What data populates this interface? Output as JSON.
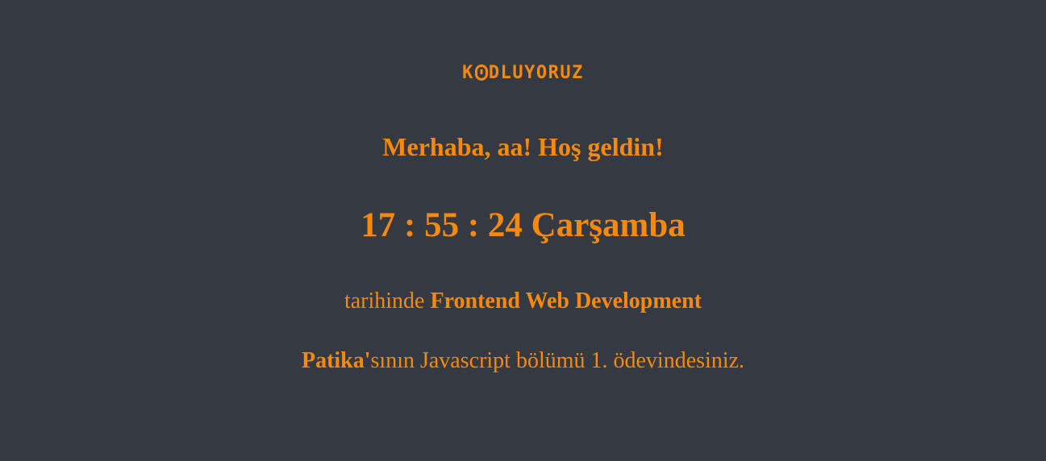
{
  "logo": {
    "text_before": "K",
    "text_after": "DLUYORUZ",
    "alt": "KODLUYORUZ"
  },
  "greeting": {
    "text": "Merhaba, aa! Hoş geldin!"
  },
  "clock": {
    "text": "17 : 55 : 24 Çarşamba"
  },
  "course": {
    "prefix": "tarihinde ",
    "name": "Frontend Web Development"
  },
  "assignment": {
    "patika": "Patika'",
    "suffix": "sının Javascript bölümü 1. ödevindesiniz."
  },
  "colors": {
    "background": "#353941",
    "accent": "#f6890e"
  }
}
